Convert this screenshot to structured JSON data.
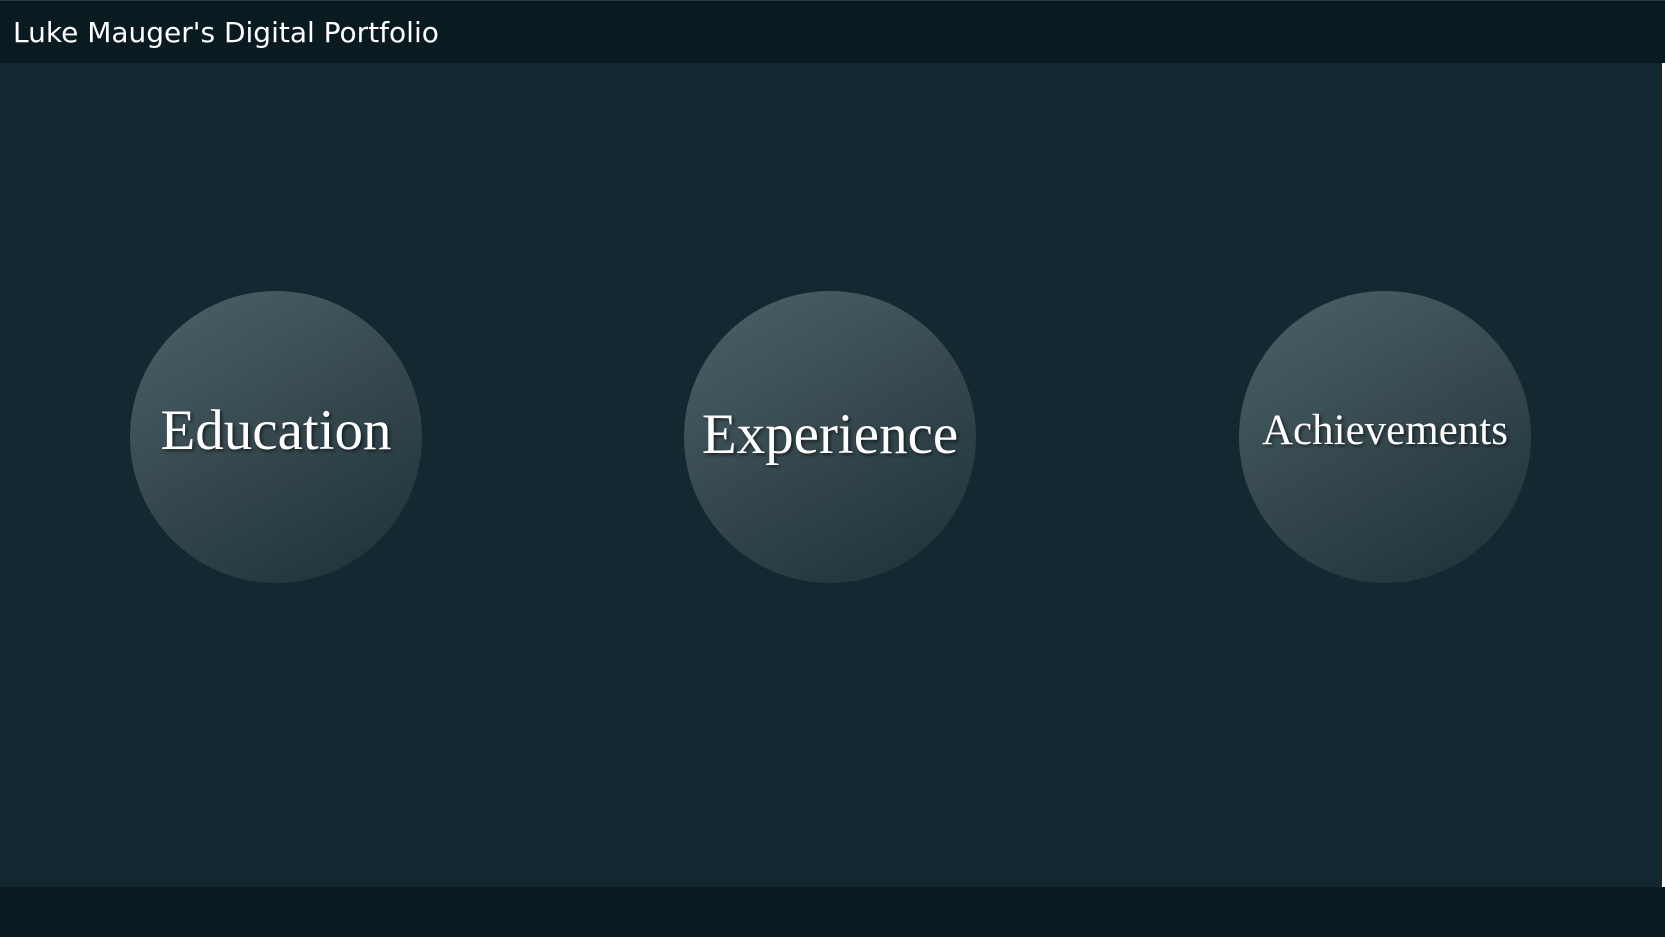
{
  "header": {
    "title": "Luke Mauger's Digital Portfolio"
  },
  "nav": {
    "items": [
      {
        "label": "Education"
      },
      {
        "label": "Experience"
      },
      {
        "label": "Achievements"
      }
    ]
  },
  "colors": {
    "header_background": "#0a1a21",
    "main_background": "#132831",
    "circle_light": "#4b636b",
    "circle_dark": "#1b3038",
    "text": "#ffffff"
  }
}
